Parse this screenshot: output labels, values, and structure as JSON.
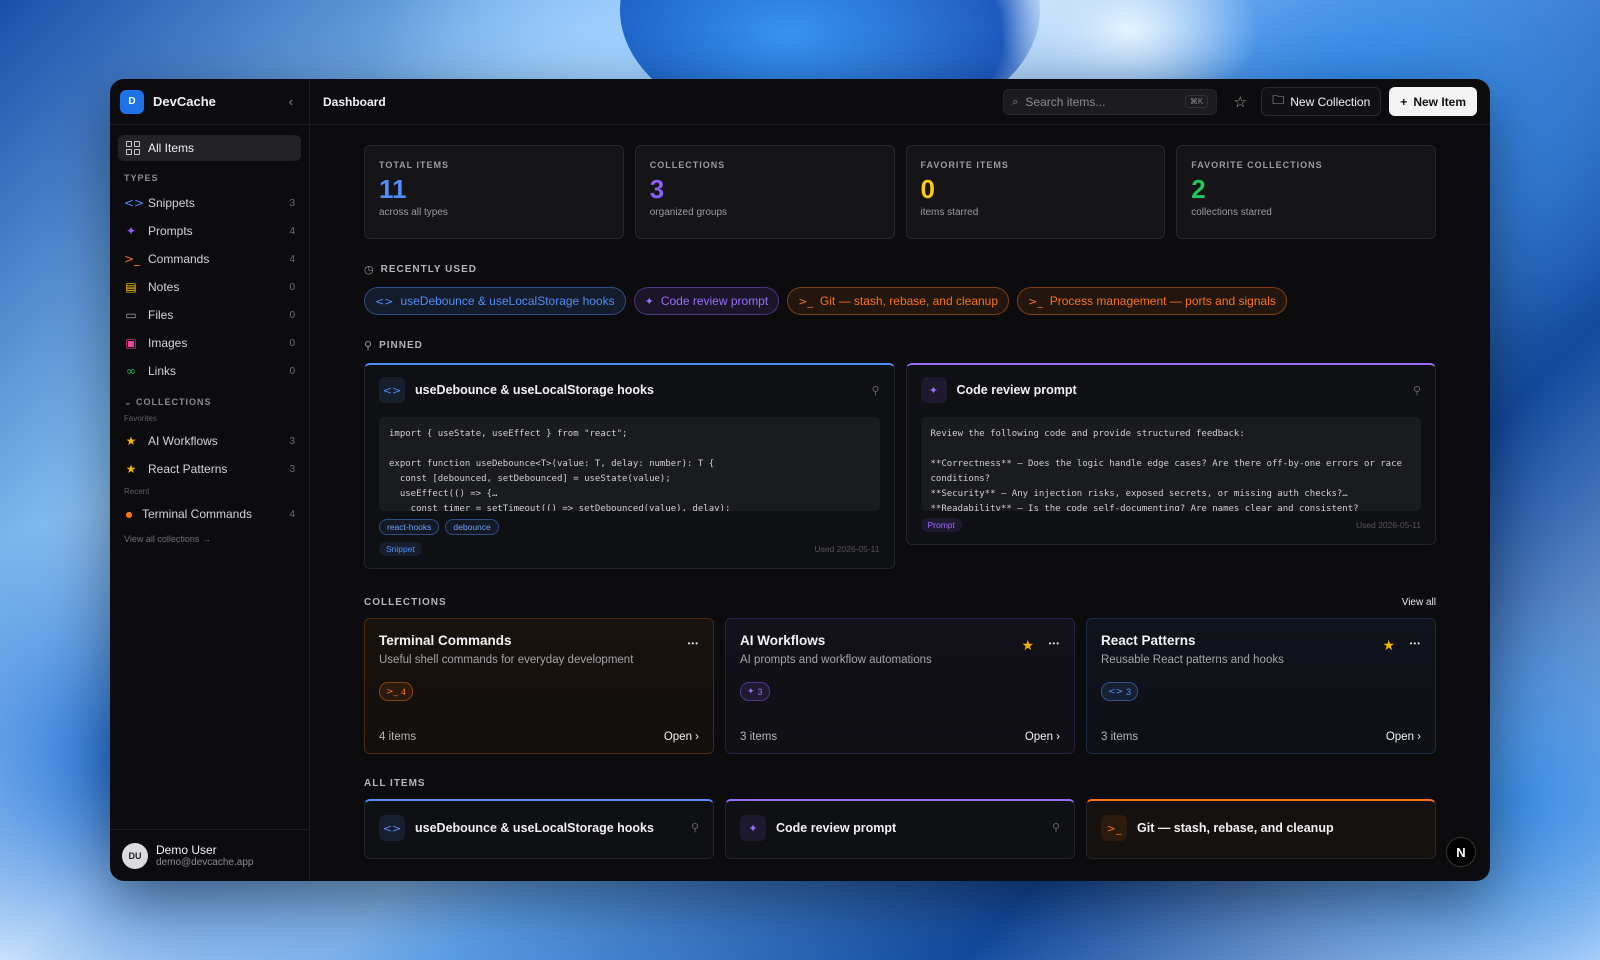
{
  "brand": {
    "logo": "D",
    "name": "DevCache"
  },
  "sidebar": {
    "all_items": "All Items",
    "types_label": "TYPES",
    "types": [
      {
        "label": "Snippets",
        "count": "3",
        "icon": "code-icon",
        "color": "#4f8ef7"
      },
      {
        "label": "Prompts",
        "count": "4",
        "icon": "sparkles-icon",
        "color": "#8b5cf6"
      },
      {
        "label": "Commands",
        "count": "4",
        "icon": "terminal-icon",
        "color": "#f97316"
      },
      {
        "label": "Notes",
        "count": "0",
        "icon": "note-icon",
        "color": "#facc15"
      },
      {
        "label": "Files",
        "count": "0",
        "icon": "file-icon",
        "color": "#a1a1aa"
      },
      {
        "label": "Images",
        "count": "0",
        "icon": "image-icon",
        "color": "#ec4899"
      },
      {
        "label": "Links",
        "count": "0",
        "icon": "link-icon",
        "color": "#22c55e"
      }
    ],
    "collections_label": "COLLECTIONS",
    "favorites_label": "Favorites",
    "favorites": [
      {
        "label": "AI Workflows",
        "count": "3"
      },
      {
        "label": "React Patterns",
        "count": "3"
      }
    ],
    "recent_label": "Recent",
    "recent": [
      {
        "label": "Terminal Commands",
        "count": "4"
      }
    ],
    "view_all": "View all collections →"
  },
  "user": {
    "initials": "DU",
    "name": "Demo User",
    "email": "demo@devcache.app"
  },
  "topbar": {
    "breadcrumb": "Dashboard",
    "search_placeholder": "Search items...",
    "search_shortcut": "⌘K",
    "new_collection": "New Collection",
    "new_item": "New Item"
  },
  "stats": [
    {
      "label": "TOTAL ITEMS",
      "value": "11",
      "sub": "across all types",
      "color": "#4f8ef7"
    },
    {
      "label": "COLLECTIONS",
      "value": "3",
      "sub": "organized groups",
      "color": "#8b5cf6"
    },
    {
      "label": "FAVORITE ITEMS",
      "value": "0",
      "sub": "items starred",
      "color": "#facc15"
    },
    {
      "label": "FAVORITE COLLECTIONS",
      "value": "2",
      "sub": "collections starred",
      "color": "#22c55e"
    }
  ],
  "recent": {
    "label": "RECENTLY USED",
    "chips": [
      {
        "label": "useDebounce & useLocalStorage hooks",
        "kind": "snippet"
      },
      {
        "label": "Code review prompt",
        "kind": "prompt"
      },
      {
        "label": "Git — stash, rebase, and cleanup",
        "kind": "command"
      },
      {
        "label": "Process management — ports and signals",
        "kind": "command"
      }
    ]
  },
  "pinned": {
    "label": "PINNED",
    "cards": [
      {
        "title": "useDebounce & useLocalStorage hooks",
        "code": "import { useState, useEffect } from \"react\";\n\nexport function useDebounce<T>(value: T, delay: number): T {\n  const [debounced, setDebounced] = useState(value);\n  useEffect(() => {…\n    const timer = setTimeout(() => setDebounced(value), delay);",
        "tags": [
          "react-hooks",
          "debounce"
        ],
        "type": "Snippet",
        "used": "Used 2026-05-11"
      },
      {
        "title": "Code review prompt",
        "code": "Review the following code and provide structured feedback:\n\n**Correctness** — Does the logic handle edge cases? Are there off-by-one errors or race\nconditions?\n**Security** — Any injection risks, exposed secrets, or missing auth checks?…\n**Readability** — Is the code self-documenting? Are names clear and consistent?",
        "tags": [],
        "type": "Prompt",
        "used": "Used 2026-05-11"
      }
    ]
  },
  "collections": {
    "label": "COLLECTIONS",
    "view_all": "View all",
    "cards": [
      {
        "title": "Terminal Commands",
        "desc": "Useful shell commands for everyday development",
        "pill_icon": ">_",
        "pill_count": "4",
        "items": "4 items",
        "open": "Open ›",
        "favorite": false,
        "kind": "command"
      },
      {
        "title": "AI Workflows",
        "desc": "AI prompts and workflow automations",
        "pill_icon": "✦",
        "pill_count": "3",
        "items": "3 items",
        "open": "Open ›",
        "favorite": true,
        "kind": "prompt"
      },
      {
        "title": "React Patterns",
        "desc": "Reusable React patterns and hooks",
        "pill_icon": "<>",
        "pill_count": "3",
        "items": "3 items",
        "open": "Open ›",
        "favorite": true,
        "kind": "snippet"
      }
    ]
  },
  "all_items": {
    "label": "ALL ITEMS",
    "cards": [
      {
        "title": "useDebounce & useLocalStorage hooks",
        "kind": "snippet"
      },
      {
        "title": "Code review prompt",
        "kind": "prompt"
      },
      {
        "title": "Git — stash, rebase, and cleanup",
        "kind": "command"
      }
    ]
  },
  "fab": "N"
}
